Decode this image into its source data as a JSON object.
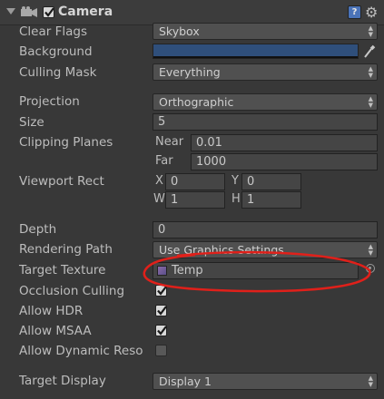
{
  "component": {
    "title": "Camera",
    "enabled": true,
    "icons": {
      "foldout": "foldout-open-icon",
      "camera": "camera-icon",
      "help": "help-icon",
      "settings": "gear-icon"
    }
  },
  "fields": {
    "clear_flags": {
      "label": "Clear Flags",
      "value": "Skybox"
    },
    "background": {
      "label": "Background",
      "color": "#2f4f7b"
    },
    "culling_mask": {
      "label": "Culling Mask",
      "value": "Everything"
    },
    "projection": {
      "label": "Projection",
      "value": "Orthographic"
    },
    "size": {
      "label": "Size",
      "value": "5"
    },
    "clipping_planes": {
      "label": "Clipping Planes",
      "near_label": "Near",
      "near": "0.01",
      "far_label": "Far",
      "far": "1000"
    },
    "viewport_rect": {
      "label": "Viewport Rect",
      "x_label": "X",
      "x": "0",
      "y_label": "Y",
      "y": "0",
      "w_label": "W",
      "w": "1",
      "h_label": "H",
      "h": "1"
    },
    "depth": {
      "label": "Depth",
      "value": "0"
    },
    "rendering_path": {
      "label": "Rendering Path",
      "value": "Use Graphics Settings"
    },
    "target_texture": {
      "label": "Target Texture",
      "value": "Temp"
    },
    "occlusion_culling": {
      "label": "Occlusion Culling",
      "checked": true
    },
    "allow_hdr": {
      "label": "Allow HDR",
      "checked": true
    },
    "allow_msaa": {
      "label": "Allow MSAA",
      "checked": true
    },
    "allow_dynamic_resolution": {
      "label": "Allow Dynamic Reso",
      "checked": false
    },
    "target_display": {
      "label": "Target Display",
      "value": "Display 1"
    }
  },
  "annotation": {
    "color": "#e0201a"
  },
  "icons": {
    "dropdown_arrows": "updown-arrows-icon",
    "eyedropper": "eyedropper-icon",
    "object_picker": "object-picker-icon",
    "render_texture": "render-texture-icon",
    "checkmark": "checkmark-icon"
  }
}
